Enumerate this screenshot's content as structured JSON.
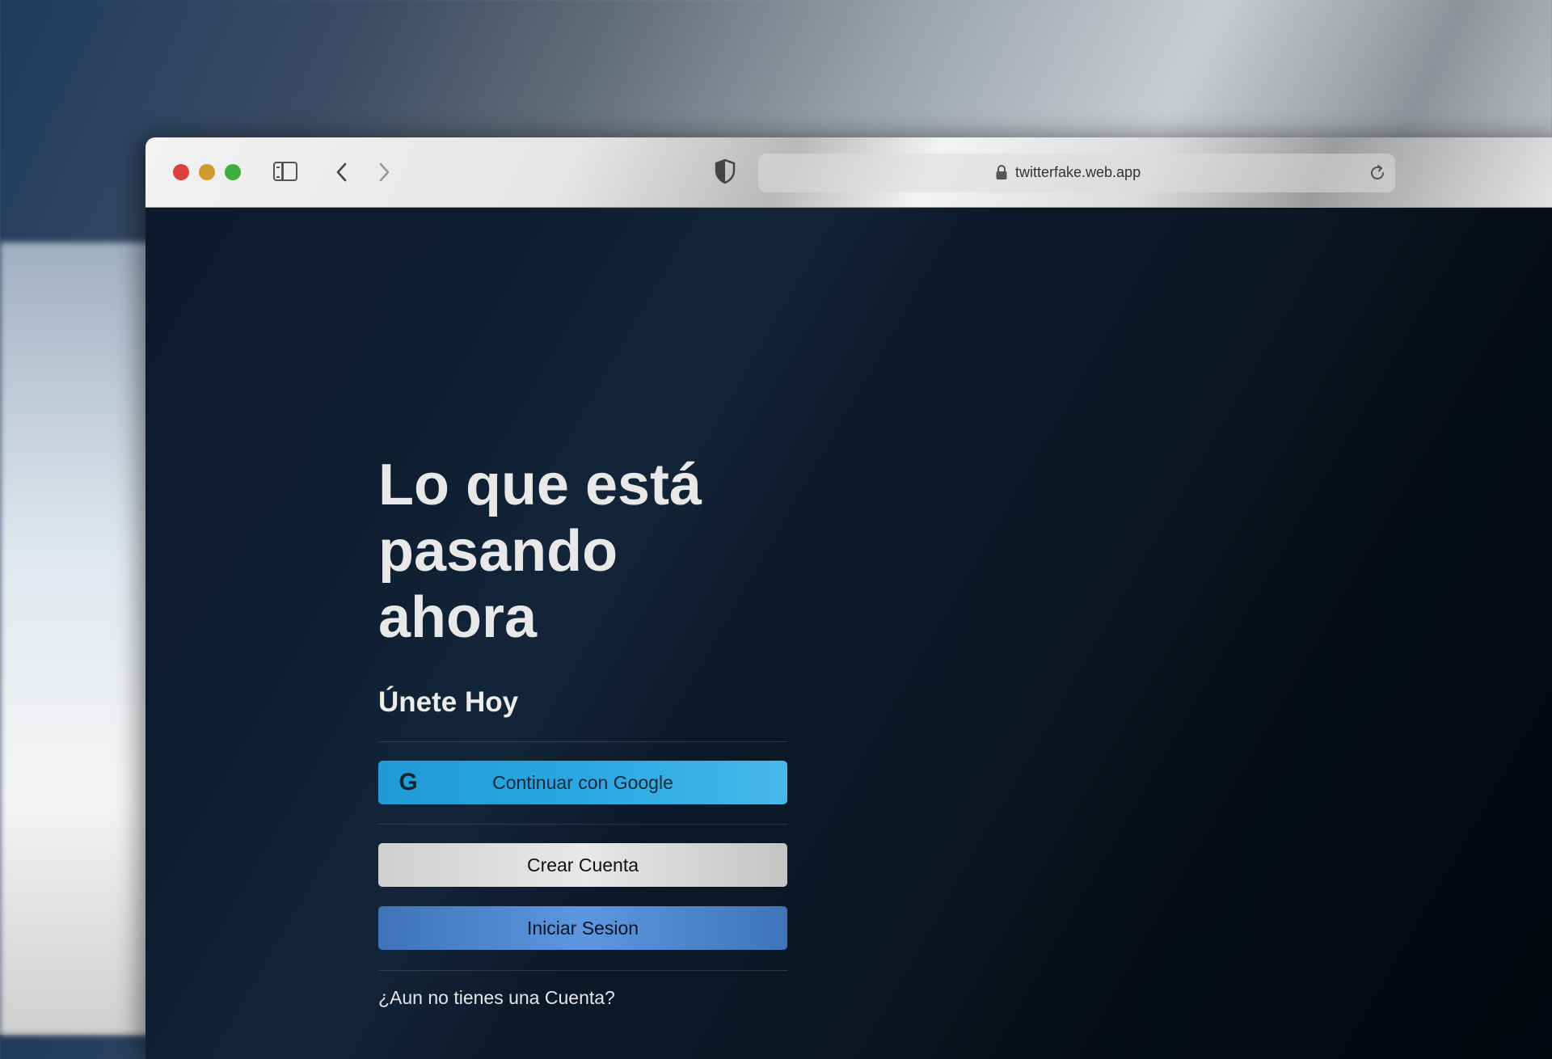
{
  "browser": {
    "url": "twitterfake.web.app"
  },
  "page": {
    "headline": "Lo que está pasando ahora",
    "subheadline": "Únete Hoy",
    "google_button_label": "Continuar con Google",
    "google_icon_glyph": "G",
    "create_account_label": "Crear Cuenta",
    "login_label": "Iniciar Sesion",
    "signup_prompt": "¿Aun no tienes una",
    "signup_link": "Cuenta?"
  },
  "colors": {
    "google_button": "#2aa7e3",
    "create_button": "#dcdcdc",
    "login_button": "#4a83cc",
    "page_background": "#0b1a2c"
  }
}
